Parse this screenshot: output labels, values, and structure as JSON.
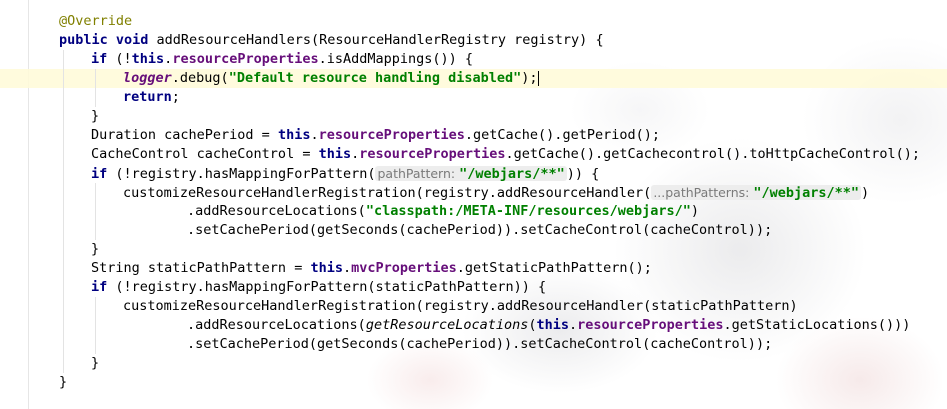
{
  "editor": {
    "language": "Java",
    "current_line_index": 3,
    "colors": {
      "keyword": "#000080",
      "annotation": "#808000",
      "field": "#660e7a",
      "string": "#008000",
      "hint_background": "#ededed",
      "current_line": "#fffad7"
    },
    "lines": [
      {
        "indent": 0,
        "tokens": [
          {
            "t": "@Override",
            "c": "ann"
          }
        ]
      },
      {
        "indent": 0,
        "tokens": [
          {
            "t": "public void ",
            "c": "kw"
          },
          {
            "t": "addResourceHandlers(ResourceHandlerRegistry registry) {"
          }
        ]
      },
      {
        "indent": 1,
        "tokens": [
          {
            "t": "if ",
            "c": "kw"
          },
          {
            "t": "(!"
          },
          {
            "t": "this",
            "c": "kw"
          },
          {
            "t": "."
          },
          {
            "t": "resourceProperties",
            "c": "fld"
          },
          {
            "t": ".isAddMappings()) {"
          }
        ]
      },
      {
        "indent": 2,
        "tokens": [
          {
            "t": "logger",
            "c": "stf"
          },
          {
            "t": ".debug("
          },
          {
            "t": "\"Default resource handling disabled\"",
            "c": "str"
          },
          {
            "t": ");"
          },
          {
            "t": "",
            "c": "caret"
          }
        ]
      },
      {
        "indent": 2,
        "tokens": [
          {
            "t": "return",
            "c": "kw"
          },
          {
            "t": ";"
          }
        ]
      },
      {
        "indent": 1,
        "tokens": [
          {
            "t": "}"
          }
        ]
      },
      {
        "indent": 1,
        "tokens": [
          {
            "t": "Duration cachePeriod = "
          },
          {
            "t": "this",
            "c": "kw"
          },
          {
            "t": "."
          },
          {
            "t": "resourceProperties",
            "c": "fld"
          },
          {
            "t": ".getCache().getPeriod();"
          }
        ]
      },
      {
        "indent": 1,
        "tokens": [
          {
            "t": "CacheControl cacheControl = "
          },
          {
            "t": "this",
            "c": "kw"
          },
          {
            "t": "."
          },
          {
            "t": "resourceProperties",
            "c": "fld"
          },
          {
            "t": ".getCache().getCachecontrol().toHttpCacheControl();"
          }
        ]
      },
      {
        "indent": 1,
        "tokens": [
          {
            "t": "if ",
            "c": "kw"
          },
          {
            "t": "(!registry.hasMappingForPattern("
          },
          {
            "t": "pathPattern: ",
            "c": "hint",
            "s": "\"/webjars/**\""
          },
          {
            "t": ")) {"
          }
        ]
      },
      {
        "indent": 2,
        "tokens": [
          {
            "t": "customizeResourceHandlerRegistration(registry.addResourceHandler("
          },
          {
            "t": "...pathPatterns: ",
            "c": "hint",
            "s": "\"/webjars/**\""
          },
          {
            "t": ")"
          }
        ]
      },
      {
        "indent": 4,
        "tokens": [
          {
            "t": ".addResourceLocations("
          },
          {
            "t": "\"classpath:/META-INF/resources/webjars/\"",
            "c": "str"
          },
          {
            "t": ")"
          }
        ]
      },
      {
        "indent": 4,
        "tokens": [
          {
            "t": ".setCachePeriod(getSeconds(cachePeriod)).setCacheControl(cacheControl));"
          }
        ]
      },
      {
        "indent": 1,
        "tokens": [
          {
            "t": "}"
          }
        ]
      },
      {
        "indent": 1,
        "tokens": [
          {
            "t": "String staticPathPattern = "
          },
          {
            "t": "this",
            "c": "kw"
          },
          {
            "t": "."
          },
          {
            "t": "mvcProperties",
            "c": "fld"
          },
          {
            "t": ".getStaticPathPattern();"
          }
        ]
      },
      {
        "indent": 1,
        "tokens": [
          {
            "t": "if ",
            "c": "kw"
          },
          {
            "t": "(!registry.hasMappingForPattern(staticPathPattern)) {"
          }
        ]
      },
      {
        "indent": 2,
        "tokens": [
          {
            "t": "customizeResourceHandlerRegistration(registry.addResourceHandler(staticPathPattern)"
          }
        ]
      },
      {
        "indent": 4,
        "tokens": [
          {
            "t": ".addResourceLocations("
          },
          {
            "t": "getResourceLocations",
            "c": "ital"
          },
          {
            "t": "("
          },
          {
            "t": "this",
            "c": "kw"
          },
          {
            "t": "."
          },
          {
            "t": "resourceProperties",
            "c": "fld"
          },
          {
            "t": ".getStaticLocations()))"
          }
        ]
      },
      {
        "indent": 4,
        "tokens": [
          {
            "t": ".setCachePeriod(getSeconds(cachePeriod)).setCacheControl(cacheControl));"
          }
        ]
      },
      {
        "indent": 1,
        "tokens": [
          {
            "t": "}"
          }
        ]
      },
      {
        "indent": 0,
        "tokens": [
          {
            "t": "}"
          }
        ]
      }
    ]
  }
}
